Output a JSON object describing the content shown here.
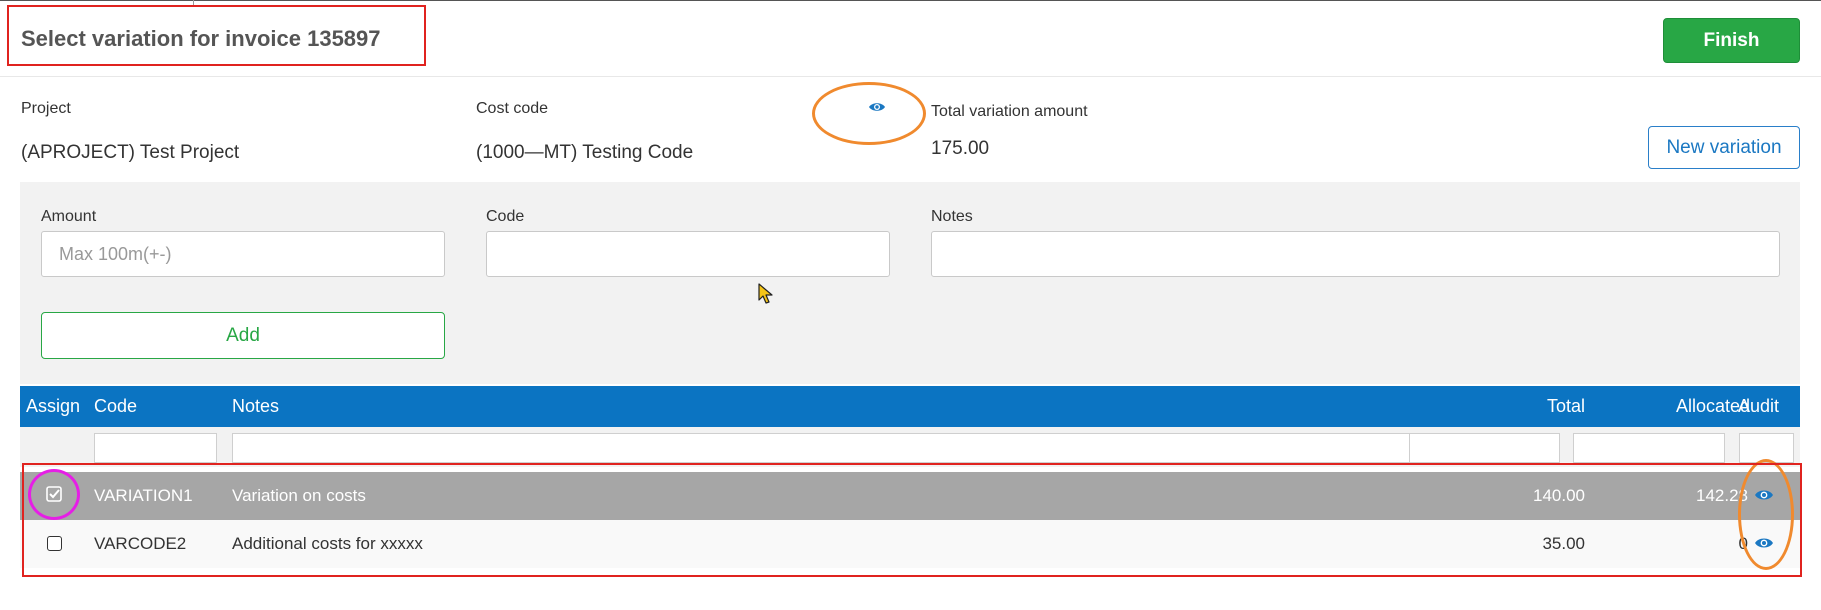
{
  "page": {
    "title": "Select variation for invoice 135897",
    "finish_label": "Finish"
  },
  "summary": {
    "project_label": "Project",
    "project_value": "(APROJECT) Test Project",
    "cost_code_label": "Cost code",
    "cost_code_value": "(1000—MT) Testing Code",
    "total_label": "Total variation amount",
    "total_value": "175.00",
    "new_variation_label": "New variation"
  },
  "form": {
    "amount_label": "Amount",
    "amount_placeholder": "Max 100m(+-)",
    "amount_value": "",
    "code_label": "Code",
    "code_value": "",
    "notes_label": "Notes",
    "notes_value": "",
    "add_label": "Add"
  },
  "table": {
    "columns": [
      "Assign",
      "Code",
      "Notes",
      "Total",
      "Allocated",
      "Audit"
    ],
    "rows": [
      {
        "assigned": true,
        "code": "VARIATION1",
        "notes": "Variation on costs",
        "total": "140.00",
        "allocated": "142.28",
        "audit_icon": "eye-icon"
      },
      {
        "assigned": false,
        "code": "VARCODE2",
        "notes": "Additional costs for xxxxx",
        "total": "35.00",
        "allocated": "0",
        "audit_icon": "eye-icon"
      }
    ]
  },
  "colors": {
    "primary": "#0b74c2",
    "success": "#28a745",
    "selected_row": "#a6a6a6",
    "annotation_red": "#e0231f",
    "annotation_orange": "#f08a2e",
    "annotation_magenta": "#e61ee6"
  }
}
